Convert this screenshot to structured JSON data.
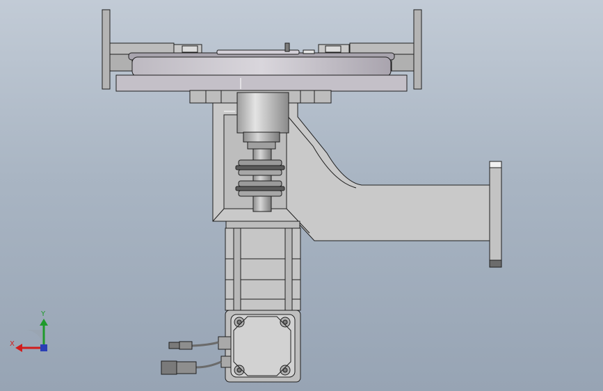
{
  "viewport": {
    "background_top": "#c2cbd6",
    "background_bottom": "#97a4b4"
  },
  "triad": {
    "x_label": "X",
    "y_label": "Y",
    "x_color": "#d21c1c",
    "y_color": "#1f9a2b",
    "z_color": "#2a3fb5"
  },
  "part_colors": {
    "body": "#c8c8c8",
    "body_dark": "#9b9b9b",
    "edge": "#1e1e1e",
    "platter": "#c6c2c9"
  }
}
